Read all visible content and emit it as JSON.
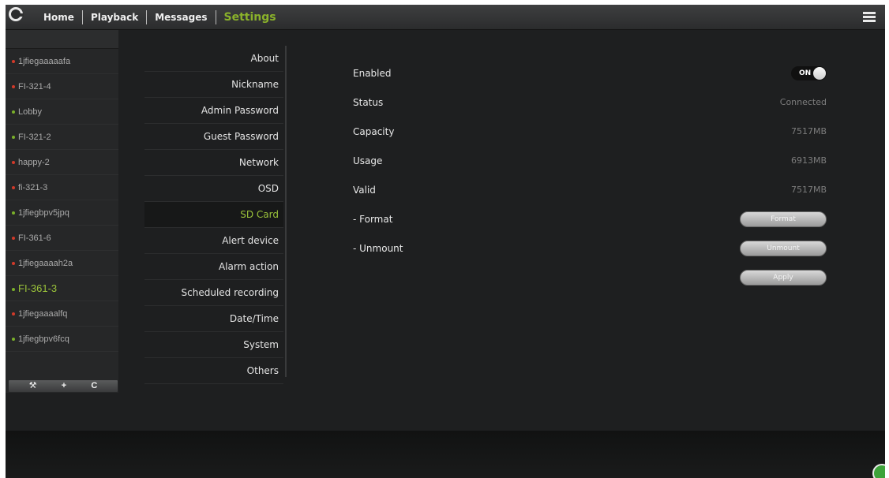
{
  "nav": {
    "items": [
      {
        "label": "Home"
      },
      {
        "label": "Playback"
      },
      {
        "label": "Messages"
      },
      {
        "label": "Settings"
      }
    ],
    "active": "Settings"
  },
  "devices": [
    {
      "name": "1jfiegaaaaafa",
      "status_color": "#d23a2a"
    },
    {
      "name": "FI-321-4",
      "status_color": "#d23a2a"
    },
    {
      "name": "Lobby",
      "status_color": "#7ab02a"
    },
    {
      "name": "FI-321-2",
      "status_color": "#7ab02a"
    },
    {
      "name": "happy-2",
      "status_color": "#d23a2a"
    },
    {
      "name": "fi-321-3",
      "status_color": "#d23a2a"
    },
    {
      "name": "1jfiegbpv5jpq",
      "status_color": "#7ab02a"
    },
    {
      "name": "FI-361-6",
      "status_color": "#d23a2a"
    },
    {
      "name": "1jfiegaaaah2a",
      "status_color": "#d23a2a"
    },
    {
      "name": "FI-361-3",
      "status_color": "#7ab02a"
    },
    {
      "name": "1jfiegaaaalfq",
      "status_color": "#d23a2a"
    },
    {
      "name": "1jfiegbpv6fcq",
      "status_color": "#7ab02a"
    }
  ],
  "selected_device": "FI-361-3",
  "device_toolbar": {
    "icons": [
      "wrench-icon",
      "plus-icon",
      "refresh-icon"
    ],
    "glyphs": [
      "🔧",
      "+",
      "C"
    ]
  },
  "settings_menu": {
    "items": [
      "About",
      "Nickname",
      "Admin Password",
      "Guest Password",
      "Network",
      "OSD",
      "SD Card",
      "Alert device",
      "Alarm action",
      "Scheduled recording",
      "Date/Time",
      "System",
      "Others"
    ],
    "active": "SD Card"
  },
  "sd_card": {
    "enabled_label": "Enabled",
    "enabled_toggle": "ON",
    "status_label": "Status",
    "status_value": "Connected",
    "capacity_label": "Capacity",
    "capacity_value": "7517MB",
    "usage_label": "Usage",
    "usage_value": "6913MB",
    "valid_label": "Valid",
    "valid_value": "7517MB",
    "format_label": "- Format",
    "format_button": "Format",
    "unmount_label": "- Unmount",
    "unmount_button": "Unmount",
    "apply_button": "Apply"
  },
  "colors": {
    "accent": "#9ac23a",
    "background": "#1e1f20"
  }
}
